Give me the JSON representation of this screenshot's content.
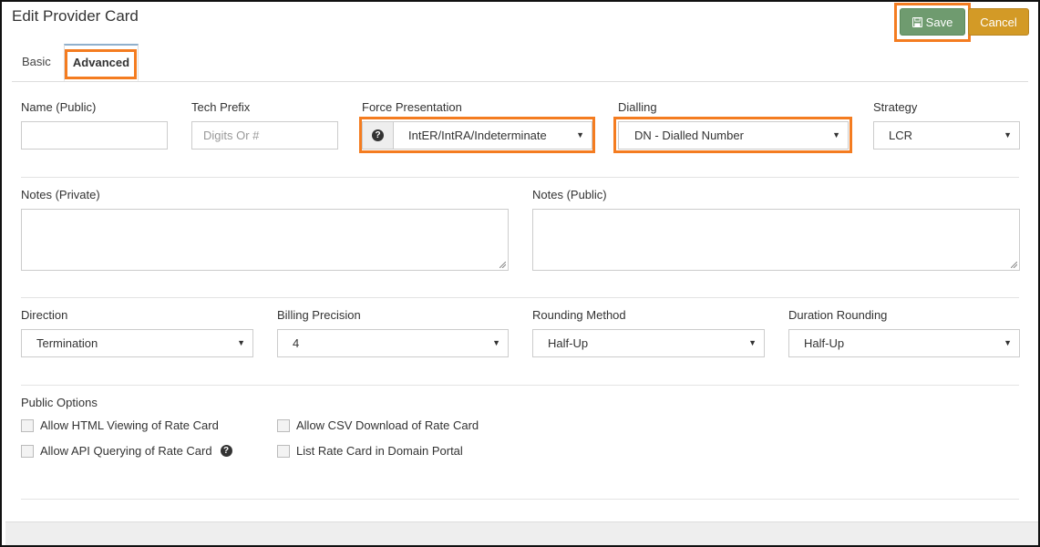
{
  "page": {
    "title": "Edit Provider Card"
  },
  "toolbar": {
    "save_label": "Save",
    "cancel_label": "Cancel"
  },
  "tabs": [
    {
      "label": "Basic"
    },
    {
      "label": "Advanced"
    }
  ],
  "fields": {
    "name_public": {
      "label": "Name (Public)",
      "value": ""
    },
    "tech_prefix": {
      "label": "Tech Prefix",
      "placeholder": "Digits Or #"
    },
    "force_presentation": {
      "label": "Force Presentation",
      "value": "IntER/IntRA/Indeterminate"
    },
    "dialling": {
      "label": "Dialling",
      "value": "DN - Dialled Number"
    },
    "strategy": {
      "label": "Strategy",
      "value": "LCR"
    },
    "notes_private": {
      "label": "Notes (Private)"
    },
    "notes_public": {
      "label": "Notes (Public)"
    },
    "direction": {
      "label": "Direction",
      "value": "Termination"
    },
    "billing_precision": {
      "label": "Billing Precision",
      "value": "4"
    },
    "rounding_method": {
      "label": "Rounding Method",
      "value": "Half-Up"
    },
    "duration_rounding": {
      "label": "Duration Rounding",
      "value": "Half-Up"
    }
  },
  "public_options": {
    "label": "Public Options",
    "items": [
      {
        "label": "Allow HTML Viewing of Rate Card",
        "checked": false
      },
      {
        "label": "Allow CSV Download of Rate Card",
        "checked": false
      },
      {
        "label": "Allow API Querying of Rate Card",
        "checked": false
      },
      {
        "label": "List Rate Card in Domain Portal",
        "checked": false
      }
    ]
  },
  "colors": {
    "save": "#6f9b6f",
    "cancel": "#d39a26",
    "highlight": "#f47c20"
  },
  "icons": {
    "save": "floppy-disk-icon",
    "help": "question-circle-icon",
    "dropdown": "caret-down-icon"
  }
}
